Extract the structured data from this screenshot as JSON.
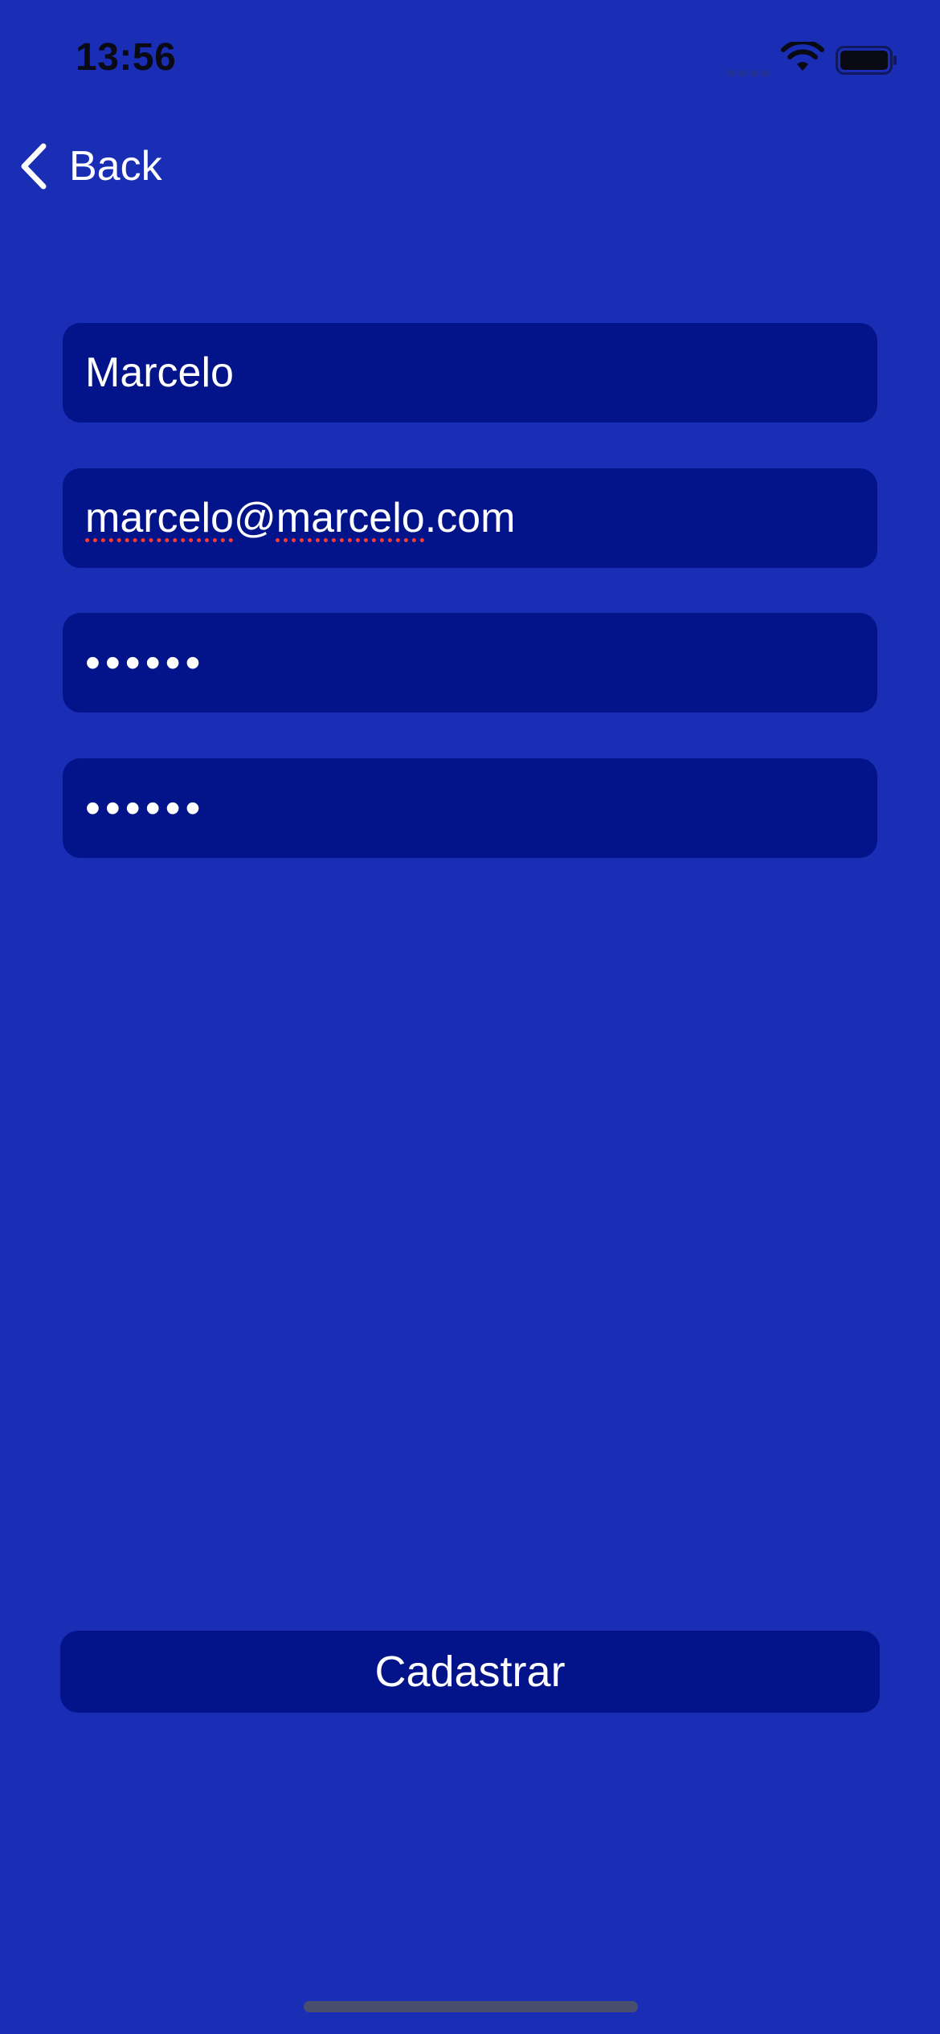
{
  "status_bar": {
    "time": "13:56"
  },
  "nav": {
    "back_label": "Back"
  },
  "form": {
    "name_value": "Marcelo",
    "email_parts": {
      "first": "marcelo",
      "at": "@",
      "second": "marcelo",
      "suffix": ".com"
    },
    "password_value": "••••••",
    "confirm_password_value": "••••••"
  },
  "submit": {
    "label": "Cadastrar"
  },
  "colors": {
    "background": "#1a2db5",
    "field_background": "#03148a",
    "text": "#ffffff",
    "spellcheck_underline": "#ff3b30"
  },
  "icons": {
    "back": "chevron-left-icon",
    "signal": "cellular-signal-icon",
    "wifi": "wifi-icon",
    "battery": "battery-icon"
  }
}
